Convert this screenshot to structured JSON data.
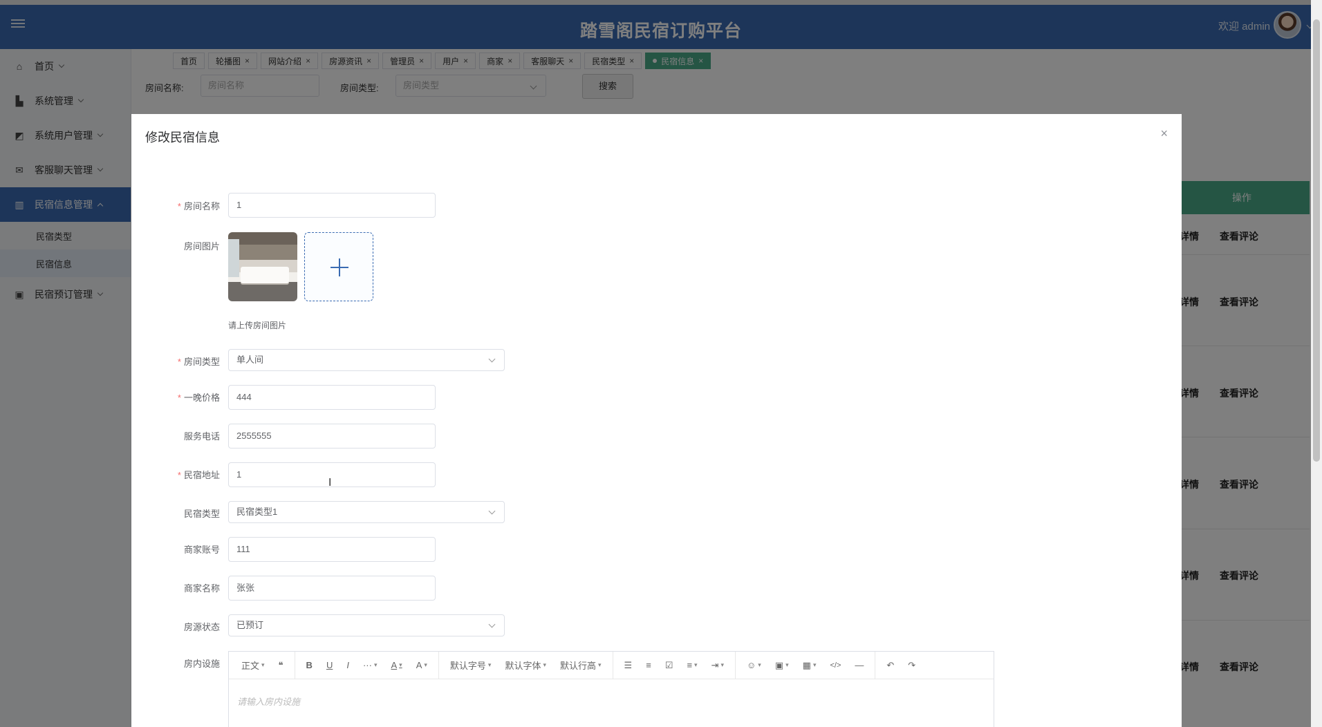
{
  "header": {
    "title": "踏雪阁民宿订购平台",
    "welcome": "欢迎 admin"
  },
  "sidebar": {
    "items": [
      {
        "label": "首页",
        "icon": "home-icon"
      },
      {
        "label": "系统管理",
        "icon": "building-icon"
      },
      {
        "label": "系统用户管理",
        "icon": "chart-icon"
      },
      {
        "label": "客服聊天管理",
        "icon": "mail-icon"
      },
      {
        "label": "民宿信息管理",
        "icon": "bank-icon"
      },
      {
        "label": "民宿预订管理",
        "icon": "cpu-icon"
      }
    ],
    "subitems": [
      {
        "label": "民宿类型"
      },
      {
        "label": "民宿信息"
      }
    ]
  },
  "tabs": [
    {
      "label": "首页"
    },
    {
      "label": "轮播图"
    },
    {
      "label": "网站介绍"
    },
    {
      "label": "房源资讯"
    },
    {
      "label": "管理员"
    },
    {
      "label": "用户"
    },
    {
      "label": "商家"
    },
    {
      "label": "客服聊天"
    },
    {
      "label": "民宿类型"
    },
    {
      "label": "民宿信息"
    }
  ],
  "filters": {
    "room_name_label": "房间名称:",
    "room_name_placeholder": "房间名称",
    "room_type_label": "房间类型:",
    "room_type_placeholder": "房间类型",
    "search_button": "搜索"
  },
  "table": {
    "operation_header": "操作",
    "detail_link": "详情",
    "review_link": "查看评论"
  },
  "dialog": {
    "title": "修改民宿信息",
    "close": "×",
    "fields": {
      "room_name": {
        "label": "房间名称",
        "value": "1"
      },
      "room_image": {
        "label": "房间图片",
        "tip": "请上传房间图片"
      },
      "room_type": {
        "label": "房间类型",
        "value": "单人间"
      },
      "price": {
        "label": "一晚价格",
        "value": "444"
      },
      "phone": {
        "label": "服务电话",
        "value": "2555555"
      },
      "address": {
        "label": "民宿地址",
        "value": "1"
      },
      "homestay_type": {
        "label": "民宿类型",
        "value": "民宿类型1"
      },
      "merchant_account": {
        "label": "商家账号",
        "value": "111"
      },
      "merchant_name": {
        "label": "商家名称",
        "value": "张张"
      },
      "status": {
        "label": "房源状态",
        "value": "已预订"
      },
      "facilities": {
        "label": "房内设施",
        "placeholder": "请输入房内设施"
      }
    },
    "editor_toolbar": {
      "paragraph": "正文",
      "quote": "❝",
      "bold": "B",
      "underline": "U",
      "italic": "I",
      "more": "···",
      "font_color": "A",
      "bg_color": "A",
      "font_size": "默认字号",
      "font_family": "默认字体",
      "line_height": "默认行高",
      "bullet_list": "☰",
      "numbered_list": "≡",
      "todo": "☑",
      "align": "≡",
      "indent": "⇥",
      "emoji": "☺",
      "image": "▣",
      "table": "▦",
      "code": "</>",
      "divider": "—",
      "undo": "↶",
      "redo": "↷"
    }
  },
  "colors": {
    "primary": "#3a6bb2",
    "accent_green": "#4aaa89",
    "required": "#f56c6c"
  }
}
